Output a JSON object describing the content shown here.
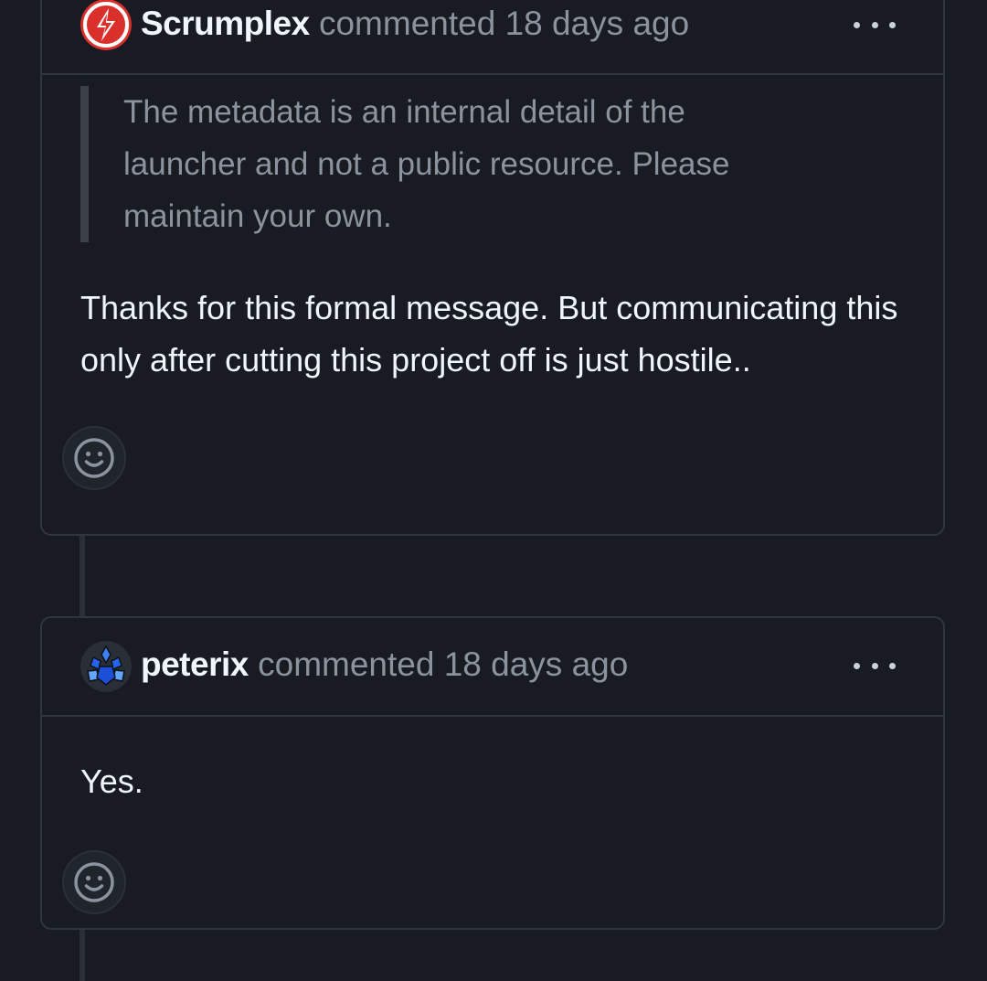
{
  "comments": [
    {
      "author": "Scrumplex",
      "meta": "commented 18 days ago",
      "avatar_icon": "scrumplex-lightning-avatar",
      "avatar_color": "#d9302c",
      "quote": "The metadata is an internal detail of the launcher and not a public resource. Please maintain your own.",
      "body": "Thanks for this formal message. But communicating this only after cutting this project off is just hostile.."
    },
    {
      "author": "peterix",
      "meta": "commented 18 days ago",
      "avatar_icon": "peterix-crystal-avatar",
      "avatar_color": "#1f6feb",
      "body": "Yes."
    }
  ],
  "icons": {
    "menu": "kebab-horizontal-icon",
    "reaction": "smiley-icon"
  },
  "colors": {
    "background": "#181b21",
    "border": "#30363d",
    "text_primary": "#f0f6fc",
    "text_muted": "#8b949e"
  }
}
